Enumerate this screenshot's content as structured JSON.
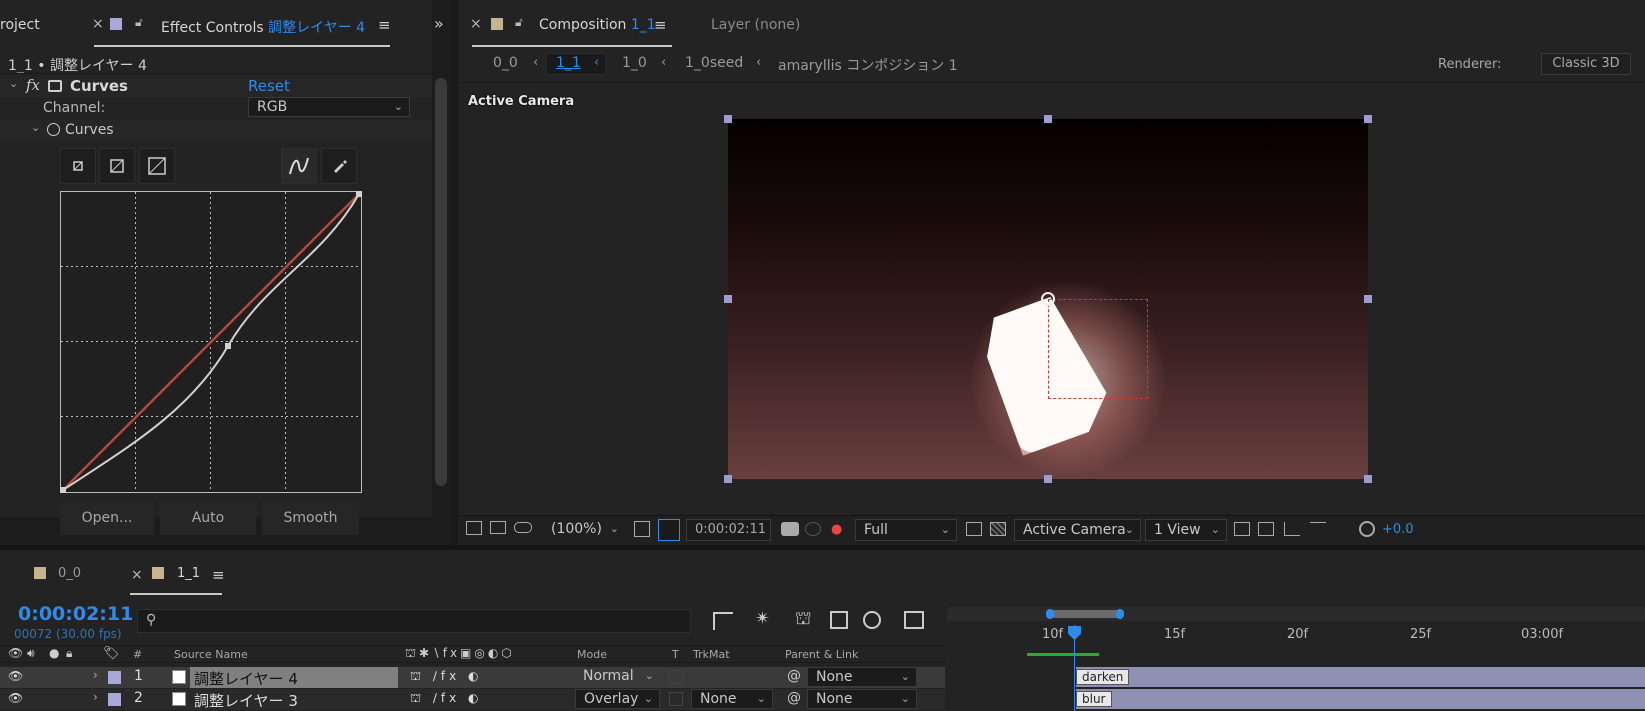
{
  "left_panel": {
    "tab_project": "roject",
    "tab_effect_controls": "Effect Controls",
    "tab_effect_layer": "調整レイヤー 4",
    "breadcrumb": "1_1 • 調整レイヤー 4",
    "effect_name": "Curves",
    "reset_label": "Reset",
    "channel_label": "Channel:",
    "channel_value": "RGB",
    "curves_prop_label": "Curves",
    "button_open": "Open...",
    "button_auto": "Auto",
    "button_smooth": "Smooth",
    "fx_label": "fx"
  },
  "composition": {
    "tab_label": "Composition",
    "tab_comp_name": "1_1",
    "layer_tab": "Layer  (none)",
    "breadcrumbs": [
      "0_0",
      "1_1",
      "1_0",
      "1_0seed",
      "amaryllis コンポジション 1"
    ],
    "renderer_label": "Renderer:",
    "renderer_value": "Classic 3D",
    "view_label": "Active Camera",
    "zoom": "(100%)",
    "timecode": "0:00:02:11",
    "resolution": "Full",
    "camera": "Active Camera",
    "views": "1 View",
    "exposure": "+0.0"
  },
  "timeline": {
    "tabs": [
      "0_0",
      "1_1"
    ],
    "timecode": "0:00:02:11",
    "frame_info": "00072 (30.00 fps)",
    "search_placeholder": "",
    "columns": {
      "hash": "#",
      "source_name": "Source Name",
      "mode": "Mode",
      "t": "T",
      "trkmat": "TrkMat",
      "parent": "Parent & Link"
    },
    "ruler": [
      "10f",
      "15f",
      "20f",
      "25f",
      "03:00f"
    ],
    "layers": [
      {
        "num": "1",
        "name": "調整レイヤー 4",
        "mode": "Normal",
        "trkmat": "",
        "parent": "None",
        "marker": "darken"
      },
      {
        "num": "2",
        "name": "調整レイヤー 3",
        "mode": "Overlay",
        "trkmat": "None",
        "parent": "None",
        "marker": "blur"
      }
    ]
  },
  "colors": {
    "accent": "#2d8ceb",
    "label_lavender": "#a9a9d8",
    "label_tan": "#c8b48c",
    "layer_bar": "#8f8eb3",
    "curve_red": "#b54a2e"
  }
}
